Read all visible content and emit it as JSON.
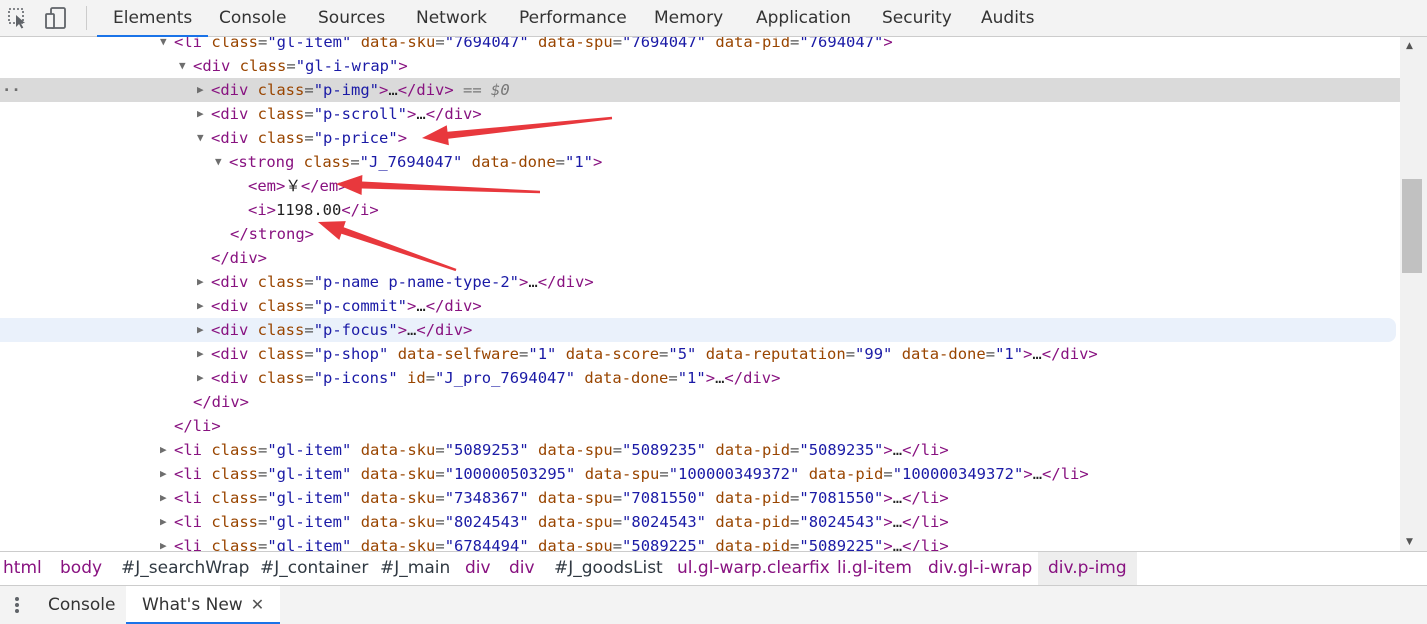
{
  "toolbar": {
    "tabs": [
      "Elements",
      "Console",
      "Sources",
      "Network",
      "Performance",
      "Memory",
      "Application",
      "Security",
      "Audits"
    ],
    "active_tab": "Elements",
    "icons": [
      "inspect-element-icon",
      "device-toolbar-icon"
    ]
  },
  "tree": {
    "lines": [
      {
        "tri": "▼",
        "parts": [
          [
            "t",
            "<li "
          ],
          [
            "an",
            "class"
          ],
          [
            "eq",
            "="
          ],
          [
            "av",
            "\"gl-item\""
          ],
          [
            "tx",
            " "
          ],
          [
            "an",
            "data-sku"
          ],
          [
            "eq",
            "="
          ],
          [
            "av",
            "\"7694047\""
          ],
          [
            "tx",
            " "
          ],
          [
            "an",
            "data-spu"
          ],
          [
            "eq",
            "="
          ],
          [
            "av",
            "\"7694047\""
          ],
          [
            "tx",
            " "
          ],
          [
            "an",
            "data-pid"
          ],
          [
            "eq",
            "="
          ],
          [
            "av",
            "\"7694047\""
          ],
          [
            "t",
            ">"
          ]
        ]
      },
      {
        "tri": "▼",
        "parts": [
          [
            "t",
            "<div "
          ],
          [
            "an",
            "class"
          ],
          [
            "eq",
            "="
          ],
          [
            "av",
            "\"gl-i-wrap\""
          ],
          [
            "t",
            ">"
          ]
        ]
      },
      {
        "tri": "▶",
        "parts": [
          [
            "t",
            "<div "
          ],
          [
            "an",
            "class"
          ],
          [
            "eq",
            "="
          ],
          [
            "av",
            "\"p-img\""
          ],
          [
            "t",
            ">"
          ],
          [
            "tx",
            "…"
          ],
          [
            "t",
            "</div>"
          ],
          [
            "hint",
            " == $0"
          ]
        ]
      },
      {
        "tri": "▶",
        "parts": [
          [
            "t",
            "<div "
          ],
          [
            "an",
            "class"
          ],
          [
            "eq",
            "="
          ],
          [
            "av",
            "\"p-scroll\""
          ],
          [
            "t",
            ">"
          ],
          [
            "tx",
            "…"
          ],
          [
            "t",
            "</div>"
          ]
        ]
      },
      {
        "tri": "▼",
        "parts": [
          [
            "t",
            "<div "
          ],
          [
            "an",
            "class"
          ],
          [
            "eq",
            "="
          ],
          [
            "av",
            "\"p-price\""
          ],
          [
            "t",
            ">"
          ]
        ]
      },
      {
        "tri": "▼",
        "parts": [
          [
            "t",
            "<strong "
          ],
          [
            "an",
            "class"
          ],
          [
            "eq",
            "="
          ],
          [
            "av",
            "\"J_7694047\""
          ],
          [
            "tx",
            " "
          ],
          [
            "an",
            "data-done"
          ],
          [
            "eq",
            "="
          ],
          [
            "av",
            "\"1\""
          ],
          [
            "t",
            ">"
          ]
        ]
      },
      {
        "tri": "",
        "parts": [
          [
            "t",
            "<em>"
          ],
          [
            "tx",
            "￥"
          ],
          [
            "t",
            "</em>"
          ]
        ]
      },
      {
        "tri": "",
        "parts": [
          [
            "t",
            "<i>"
          ],
          [
            "tx",
            "1198.00"
          ],
          [
            "t",
            "</i>"
          ]
        ]
      },
      {
        "tri": "",
        "parts": [
          [
            "t",
            "</strong>"
          ]
        ]
      },
      {
        "tri": "",
        "parts": [
          [
            "t",
            "</div>"
          ]
        ]
      },
      {
        "tri": "▶",
        "parts": [
          [
            "t",
            "<div "
          ],
          [
            "an",
            "class"
          ],
          [
            "eq",
            "="
          ],
          [
            "av",
            "\"p-name p-name-type-2\""
          ],
          [
            "t",
            ">"
          ],
          [
            "tx",
            "…"
          ],
          [
            "t",
            "</div>"
          ]
        ]
      },
      {
        "tri": "▶",
        "parts": [
          [
            "t",
            "<div "
          ],
          [
            "an",
            "class"
          ],
          [
            "eq",
            "="
          ],
          [
            "av",
            "\"p-commit\""
          ],
          [
            "t",
            ">"
          ],
          [
            "tx",
            "…"
          ],
          [
            "t",
            "</div>"
          ]
        ]
      },
      {
        "tri": "▶",
        "parts": [
          [
            "t",
            "<div "
          ],
          [
            "an",
            "class"
          ],
          [
            "eq",
            "="
          ],
          [
            "av",
            "\"p-focus\""
          ],
          [
            "t",
            ">"
          ],
          [
            "tx",
            "…"
          ],
          [
            "t",
            "</div>"
          ]
        ]
      },
      {
        "tri": "▶",
        "parts": [
          [
            "t",
            "<div "
          ],
          [
            "an",
            "class"
          ],
          [
            "eq",
            "="
          ],
          [
            "av",
            "\"p-shop\""
          ],
          [
            "tx",
            " "
          ],
          [
            "an",
            "data-selfware"
          ],
          [
            "eq",
            "="
          ],
          [
            "av",
            "\"1\""
          ],
          [
            "tx",
            " "
          ],
          [
            "an",
            "data-score"
          ],
          [
            "eq",
            "="
          ],
          [
            "av",
            "\"5\""
          ],
          [
            "tx",
            " "
          ],
          [
            "an",
            "data-reputation"
          ],
          [
            "eq",
            "="
          ],
          [
            "av",
            "\"99\""
          ],
          [
            "tx",
            " "
          ],
          [
            "an",
            "data-done"
          ],
          [
            "eq",
            "="
          ],
          [
            "av",
            "\"1\""
          ],
          [
            "t",
            ">"
          ],
          [
            "tx",
            "…"
          ],
          [
            "t",
            "</div>"
          ]
        ]
      },
      {
        "tri": "▶",
        "parts": [
          [
            "t",
            "<div "
          ],
          [
            "an",
            "class"
          ],
          [
            "eq",
            "="
          ],
          [
            "av",
            "\"p-icons\""
          ],
          [
            "tx",
            " "
          ],
          [
            "an",
            "id"
          ],
          [
            "eq",
            "="
          ],
          [
            "av",
            "\"J_pro_7694047\""
          ],
          [
            "tx",
            " "
          ],
          [
            "an",
            "data-done"
          ],
          [
            "eq",
            "="
          ],
          [
            "av",
            "\"1\""
          ],
          [
            "t",
            ">"
          ],
          [
            "tx",
            "…"
          ],
          [
            "t",
            "</div>"
          ]
        ]
      },
      {
        "tri": "",
        "parts": [
          [
            "t",
            "</div>"
          ]
        ]
      },
      {
        "tri": "",
        "parts": [
          [
            "t",
            "</li>"
          ]
        ]
      },
      {
        "tri": "▶",
        "parts": [
          [
            "t",
            "<li "
          ],
          [
            "an",
            "class"
          ],
          [
            "eq",
            "="
          ],
          [
            "av",
            "\"gl-item\""
          ],
          [
            "tx",
            " "
          ],
          [
            "an",
            "data-sku"
          ],
          [
            "eq",
            "="
          ],
          [
            "av",
            "\"5089253\""
          ],
          [
            "tx",
            " "
          ],
          [
            "an",
            "data-spu"
          ],
          [
            "eq",
            "="
          ],
          [
            "av",
            "\"5089235\""
          ],
          [
            "tx",
            " "
          ],
          [
            "an",
            "data-pid"
          ],
          [
            "eq",
            "="
          ],
          [
            "av",
            "\"5089235\""
          ],
          [
            "t",
            ">"
          ],
          [
            "tx",
            "…"
          ],
          [
            "t",
            "</li>"
          ]
        ]
      },
      {
        "tri": "▶",
        "parts": [
          [
            "t",
            "<li "
          ],
          [
            "an",
            "class"
          ],
          [
            "eq",
            "="
          ],
          [
            "av",
            "\"gl-item\""
          ],
          [
            "tx",
            " "
          ],
          [
            "an",
            "data-sku"
          ],
          [
            "eq",
            "="
          ],
          [
            "av",
            "\"100000503295\""
          ],
          [
            "tx",
            " "
          ],
          [
            "an",
            "data-spu"
          ],
          [
            "eq",
            "="
          ],
          [
            "av",
            "\"100000349372\""
          ],
          [
            "tx",
            " "
          ],
          [
            "an",
            "data-pid"
          ],
          [
            "eq",
            "="
          ],
          [
            "av",
            "\"100000349372\""
          ],
          [
            "t",
            ">"
          ],
          [
            "tx",
            "…"
          ],
          [
            "t",
            "</li>"
          ]
        ]
      },
      {
        "tri": "▶",
        "parts": [
          [
            "t",
            "<li "
          ],
          [
            "an",
            "class"
          ],
          [
            "eq",
            "="
          ],
          [
            "av",
            "\"gl-item\""
          ],
          [
            "tx",
            " "
          ],
          [
            "an",
            "data-sku"
          ],
          [
            "eq",
            "="
          ],
          [
            "av",
            "\"7348367\""
          ],
          [
            "tx",
            " "
          ],
          [
            "an",
            "data-spu"
          ],
          [
            "eq",
            "="
          ],
          [
            "av",
            "\"7081550\""
          ],
          [
            "tx",
            " "
          ],
          [
            "an",
            "data-pid"
          ],
          [
            "eq",
            "="
          ],
          [
            "av",
            "\"7081550\""
          ],
          [
            "t",
            ">"
          ],
          [
            "tx",
            "…"
          ],
          [
            "t",
            "</li>"
          ]
        ]
      },
      {
        "tri": "▶",
        "parts": [
          [
            "t",
            "<li "
          ],
          [
            "an",
            "class"
          ],
          [
            "eq",
            "="
          ],
          [
            "av",
            "\"gl-item\""
          ],
          [
            "tx",
            " "
          ],
          [
            "an",
            "data-sku"
          ],
          [
            "eq",
            "="
          ],
          [
            "av",
            "\"8024543\""
          ],
          [
            "tx",
            " "
          ],
          [
            "an",
            "data-spu"
          ],
          [
            "eq",
            "="
          ],
          [
            "av",
            "\"8024543\""
          ],
          [
            "tx",
            " "
          ],
          [
            "an",
            "data-pid"
          ],
          [
            "eq",
            "="
          ],
          [
            "av",
            "\"8024543\""
          ],
          [
            "t",
            ">"
          ],
          [
            "tx",
            "…"
          ],
          [
            "t",
            "</li>"
          ]
        ]
      },
      {
        "tri": "▶",
        "parts": [
          [
            "t",
            "<li "
          ],
          [
            "an",
            "class"
          ],
          [
            "eq",
            "="
          ],
          [
            "av",
            "\"gl-item\""
          ],
          [
            "tx",
            " "
          ],
          [
            "an",
            "data-sku"
          ],
          [
            "eq",
            "="
          ],
          [
            "av",
            "\"6784494\""
          ],
          [
            "tx",
            " "
          ],
          [
            "an",
            "data-spu"
          ],
          [
            "eq",
            "="
          ],
          [
            "av",
            "\"5089225\""
          ],
          [
            "tx",
            " "
          ],
          [
            "an",
            "data-pid"
          ],
          [
            "eq",
            "="
          ],
          [
            "av",
            "\"5089225\""
          ],
          [
            "t",
            ">"
          ],
          [
            "tx",
            "…"
          ],
          [
            "t",
            "</li>"
          ]
        ]
      }
    ],
    "selected_line": 2,
    "hover_line": 12
  },
  "breadcrumb": [
    {
      "label": "html",
      "kind": "tag"
    },
    {
      "label": "body",
      "kind": "tag"
    },
    {
      "label": "#J_searchWrap",
      "kind": "id"
    },
    {
      "label": "#J_container",
      "kind": "id"
    },
    {
      "label": "#J_main",
      "kind": "id"
    },
    {
      "label": "div",
      "kind": "tag"
    },
    {
      "label": "div",
      "kind": "tag"
    },
    {
      "label": "#J_goodsList",
      "kind": "id"
    },
    {
      "label": "ul.gl-warp.clearfix",
      "kind": "cls"
    },
    {
      "label": "li.gl-item",
      "kind": "cls"
    },
    {
      "label": "div.gl-i-wrap",
      "kind": "cls"
    },
    {
      "label": "div.p-img",
      "kind": "cls",
      "active": true
    }
  ],
  "drawer": {
    "tabs": [
      "Console",
      "What's New"
    ],
    "active_tab": "What's New",
    "close_glyph": "✕"
  },
  "colors": {
    "tag": "#881280",
    "attr_name": "#994500",
    "attr_value": "#1a1aa6",
    "annotation_arrow": "#e8383d",
    "selection": "#dadada",
    "accent": "#1a73e8"
  }
}
